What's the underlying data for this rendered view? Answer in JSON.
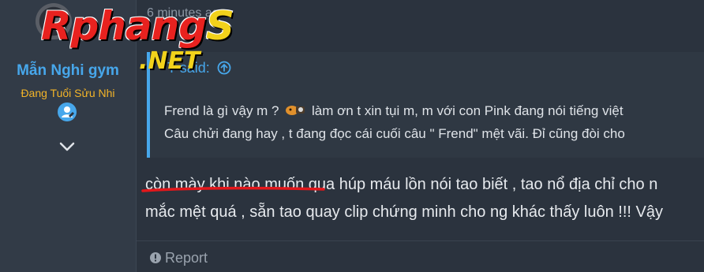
{
  "logo": {
    "brand_main": "Rphang",
    "brand_tail": "S",
    "brand_net": ".NET"
  },
  "user": {
    "name": "Mẫn Nghi gym",
    "title": "Đang Tuổi Sửu Nhi",
    "badge_icon": "user-edit-icon",
    "expand_icon": "chevron-down-icon"
  },
  "post": {
    "time": "6 minutes ago",
    "quote": {
      "author_visible": "T",
      "said_label": "said:",
      "line1_before_emoji": "Frend là gì vậy m ?",
      "line1_after_emoji": "làm ơn t xin tụi m, m với con Pink đang nói tiếng việt",
      "line2": "Câu chửi đang hay , t đang đọc cái cuối câu \" Frend\" mệt vãi. Đỉ cũng đòi cho"
    },
    "body": {
      "line1": "còn mày khi nào muốn qua húp máu lồn nói tao biết , tao nổ địa chỉ cho n",
      "line2": "mắc mệt quá , sẵn tao quay clip chứng minh cho ng khác thấy luôn !!! Vậy"
    },
    "report_label": "Report"
  },
  "colors": {
    "accent": "#47a7eb",
    "user_title": "#f3b428",
    "highlight_underline": "#e3171b"
  }
}
